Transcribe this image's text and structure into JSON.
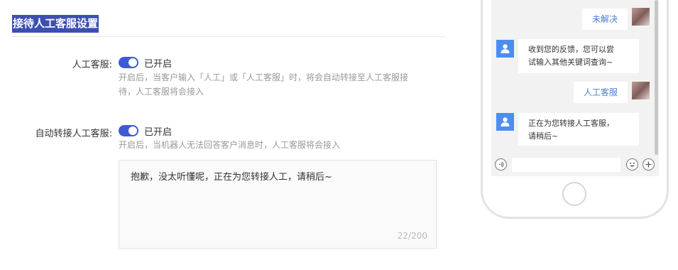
{
  "section": {
    "title": "接待人工客服设置"
  },
  "human_service": {
    "label": "人工客服:",
    "status": "已开启",
    "help_line1": "开启后，当客户输入「人工」或「人工客服」时，将会自动转接至人工客服接",
    "help_line2": "待，人工客服将会接入"
  },
  "auto_transfer": {
    "label": "自动转接人工客服:",
    "status": "已开启",
    "help": "开启后，当机器人无法回答客户消息时，人工客服将会接入",
    "reply_text": "抱歉，没太听懂呢，正在为您转接人工，请稍后~",
    "reply_count": "22/200"
  },
  "preview": {
    "messages": [
      {
        "from": "user",
        "text": "未解决"
      },
      {
        "from": "bot",
        "line1": "收到您的反馈，您可以尝",
        "line2": "试输入其他关键词查询~"
      },
      {
        "from": "user",
        "text": "人工客服"
      },
      {
        "from": "bot",
        "line1": "正在为您转接人工客服，",
        "line2": "请稍后~"
      }
    ]
  },
  "colors": {
    "accent": "#3e5bd6",
    "title_bg": "#3d4fb0",
    "bot_avatar": "#4b8ef0",
    "user_bubble_text": "#4a7fd6"
  },
  "icons": [
    "voice-icon",
    "emoji-icon",
    "plus-icon",
    "bot-avatar-icon"
  ]
}
